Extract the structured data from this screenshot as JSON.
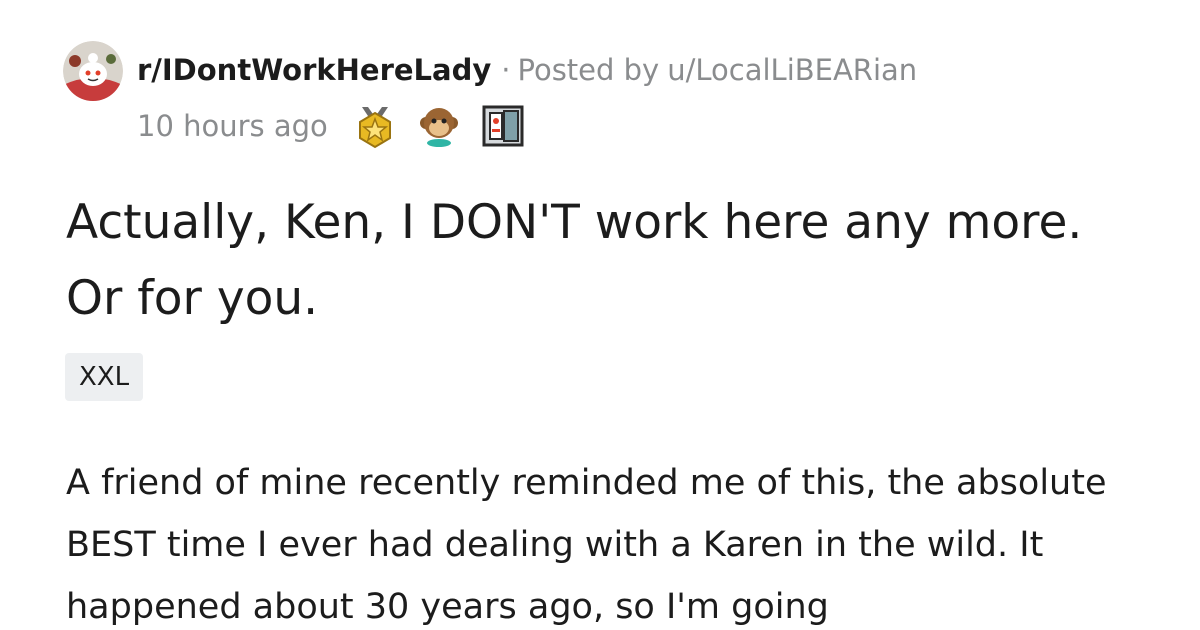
{
  "post_header": {
    "subreddit": "r/IDontWorkHereLady",
    "separator": "·",
    "posted_by_prefix": "Posted by",
    "username": "u/LocalLiBEARian",
    "timestamp": "10 hours ago",
    "avatar_icon": "snoo-avatar-icon",
    "awards": [
      "gold-medal-award-icon",
      "monkey-award-icon",
      "robot-award-icon"
    ]
  },
  "post": {
    "title": "Actually, Ken, I DON'T work here any more. Or for you.",
    "flair": "XXL",
    "body_preview": "A friend of mine recently reminded me of this, the absolute BEST time I ever had dealing with a Karen in the wild. It happened about 30 years ago, so I'm going"
  },
  "colors": {
    "text_primary": "#1c1c1c",
    "text_meta": "#8a8c8e",
    "flair_bg": "#edeff1",
    "background": "#ffffff"
  }
}
